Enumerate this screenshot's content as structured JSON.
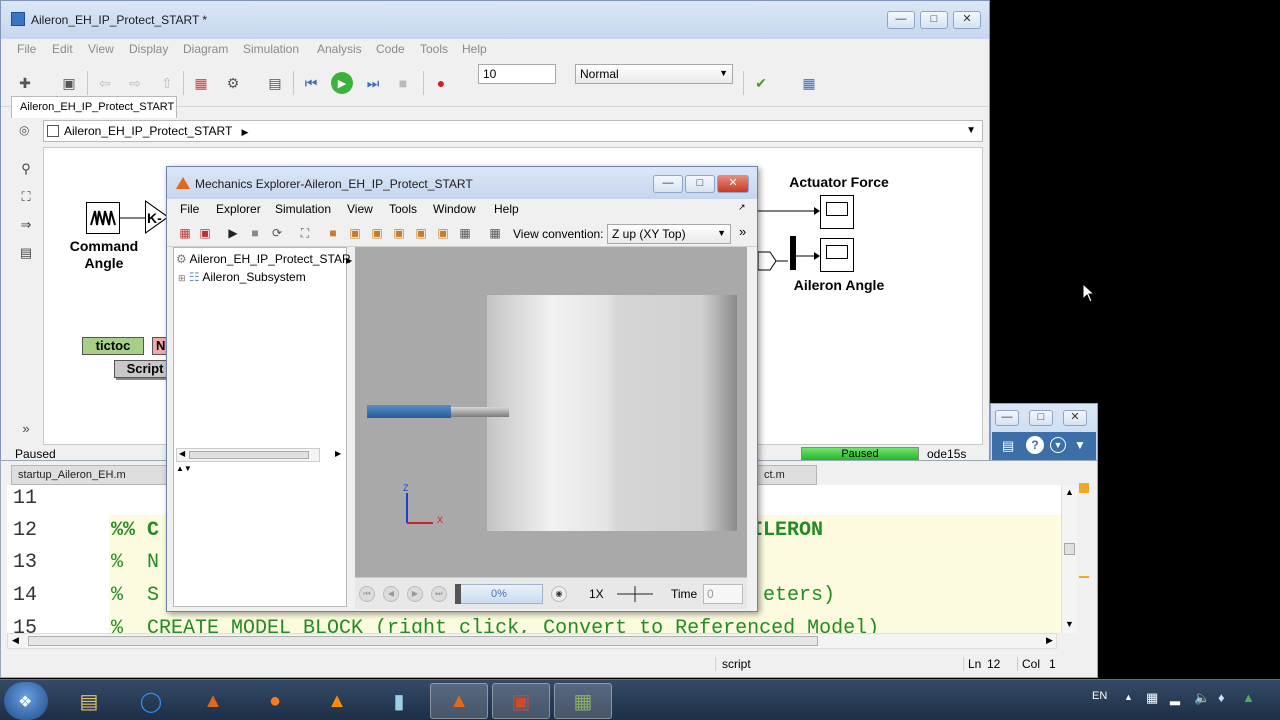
{
  "simulink": {
    "title": "Aileron_EH_IP_Protect_START *",
    "menu": [
      "File",
      "Edit",
      "View",
      "Display",
      "Diagram",
      "Simulation",
      "Analysis",
      "Code",
      "Tools",
      "Help"
    ],
    "stop_time": "10",
    "sim_mode": "Normal",
    "tab_label": "Aileron_EH_IP_Protect_START",
    "breadcrumb": "Aileron_EH_IP_Protect_START",
    "blocks": {
      "command_angle": "Command\nAngle",
      "gain": "K-",
      "actuator_force": "Actuator Force",
      "aileron_angle": "Aileron Angle",
      "tictoc": "tictoc",
      "script": "Script",
      "partial": "No"
    },
    "status_left": "Paused",
    "status_progress": "Paused",
    "solver": "ode15s"
  },
  "mechanics": {
    "title": "Mechanics Explorer-Aileron_EH_IP_Protect_START",
    "menu": [
      "File",
      "Explorer",
      "Simulation",
      "View",
      "Tools",
      "Window",
      "Help"
    ],
    "view_convention_label": "View convention:",
    "view_convention": "Z up (XY Top)",
    "tree_root": "Aileron_EH_IP_Protect_STAR",
    "tree_child": "Aileron_Subsystem",
    "progress": "0%",
    "speed": "1X",
    "time_label": "Time",
    "time_value": "0",
    "axis_z": "Z",
    "axis_x": "X"
  },
  "editor": {
    "tabs": [
      "startup_Aileron_EH.m",
      "ct.m"
    ],
    "line_numbers": [
      "11",
      "12",
      "13",
      "14",
      "15"
    ],
    "lines": [
      "",
      "%% C",
      "%  N",
      "%  S",
      "%  CREATE MODEL BLOCK (right click, Convert to Referenced Model)"
    ],
    "line12_tail": "ILERON",
    "line14_tail": "eters)",
    "status_mode": "script",
    "ln_label": "Ln",
    "ln_value": "12",
    "col_label": "Col",
    "col_value": "1"
  },
  "taskbar": {
    "lang": "EN"
  },
  "colors": {
    "code_green": "#228b22",
    "cell_bg": "#fcfbe0",
    "tictoc_green": "#a8cf86",
    "status_green": "#2ecc40"
  }
}
